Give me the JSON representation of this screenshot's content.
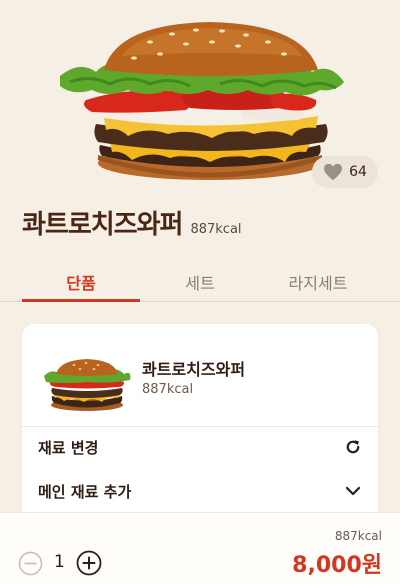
{
  "product": {
    "name": "콰트로치즈와퍼",
    "kcal": "887kcal",
    "likes": "64"
  },
  "tabs": [
    {
      "label": "단품",
      "active": true
    },
    {
      "label": "세트",
      "active": false
    },
    {
      "label": "라지세트",
      "active": false
    }
  ],
  "card": {
    "item_name": "콰트로치즈와퍼",
    "item_kcal": "887kcal",
    "options": [
      {
        "label": "재료 변경",
        "icon": "refresh-icon"
      },
      {
        "label": "메인 재료 추가",
        "icon": "chevron-down-icon"
      }
    ]
  },
  "order": {
    "quantity": "1",
    "total_kcal": "887kcal",
    "price": "8,000원"
  },
  "colors": {
    "accent": "#d2381d",
    "background": "#f5efe6",
    "title": "#4a2614"
  }
}
